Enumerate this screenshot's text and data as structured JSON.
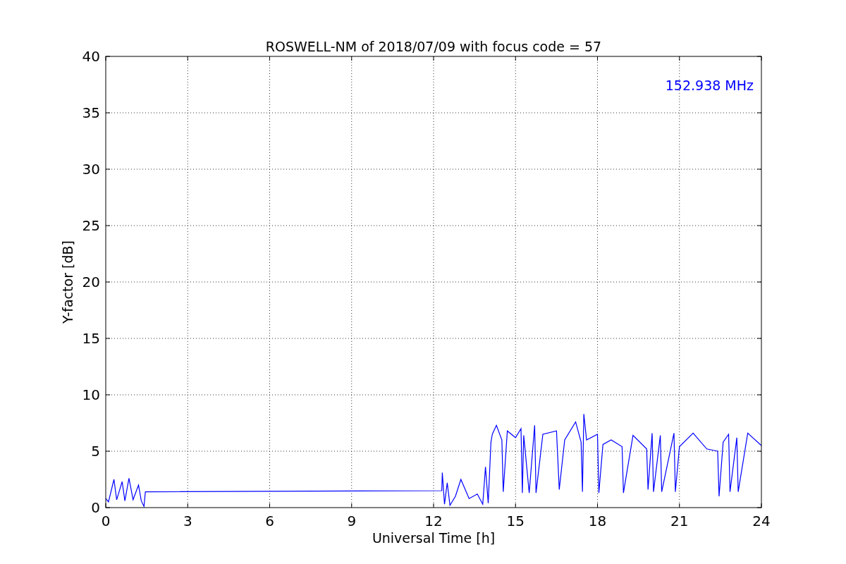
{
  "figure": {
    "chart_data": {
      "type": "line",
      "title": "ROSWELL-NM of 2018/07/09 with focus code = 57",
      "xlabel": "Universal Time [h]",
      "ylabel": "Y-factor [dB]",
      "x": [
        0,
        0.1,
        0.3,
        0.4,
        0.6,
        0.7,
        0.85,
        1.0,
        1.2,
        1.3,
        1.4,
        1.45,
        12.3,
        12.32,
        12.4,
        12.5,
        12.6,
        12.8,
        13.0,
        13.3,
        13.6,
        13.8,
        13.9,
        14.0,
        14.1,
        14.15,
        14.3,
        14.5,
        14.55,
        14.7,
        15.0,
        15.2,
        15.25,
        15.3,
        15.5,
        15.7,
        15.75,
        16.0,
        16.5,
        16.6,
        16.8,
        17.2,
        17.4,
        17.45,
        17.5,
        17.6,
        18.0,
        18.05,
        18.2,
        18.5,
        18.9,
        18.95,
        19.3,
        19.8,
        19.85,
        20.0,
        20.05,
        20.3,
        20.35,
        20.8,
        20.85,
        21.0,
        21.5,
        22.0,
        22.4,
        22.45,
        22.6,
        22.8,
        22.85,
        23.1,
        23.15,
        23.5,
        24
      ],
      "series": [
        {
          "name": "152.938 MHz",
          "color": "#0000ff",
          "values": [
            0.8,
            0.5,
            2.5,
            0.7,
            2.3,
            0.6,
            2.6,
            0.7,
            2.0,
            0.6,
            0.1,
            1.4,
            1.5,
            3.1,
            0.3,
            2.2,
            0.2,
            1.0,
            2.5,
            0.8,
            1.2,
            0.3,
            3.6,
            0.4,
            5.8,
            6.5,
            7.3,
            6.0,
            1.4,
            6.8,
            6.2,
            7.0,
            1.3,
            6.4,
            1.3,
            7.3,
            1.3,
            6.5,
            6.8,
            1.6,
            6.0,
            7.6,
            5.8,
            1.4,
            8.3,
            6.0,
            6.5,
            1.3,
            5.6,
            6.0,
            5.4,
            1.3,
            6.4,
            5.2,
            1.6,
            6.6,
            1.4,
            6.4,
            1.4,
            6.6,
            1.4,
            5.4,
            6.6,
            5.2,
            5.0,
            1.0,
            5.8,
            6.5,
            1.4,
            6.2,
            1.4,
            6.6,
            5.5
          ]
        }
      ],
      "xlim": [
        0,
        24
      ],
      "ylim": [
        0,
        40
      ],
      "xticks": [
        0,
        3,
        6,
        9,
        12,
        15,
        18,
        21,
        24
      ],
      "yticks": [
        0,
        5,
        10,
        15,
        20,
        25,
        30,
        35,
        40
      ],
      "grid": true
    }
  }
}
